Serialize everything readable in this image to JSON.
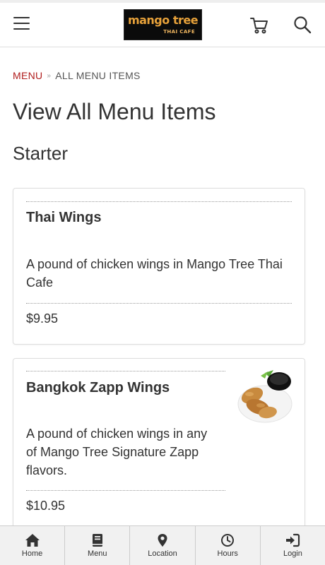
{
  "header": {
    "logo": {
      "main": "mango tree",
      "sub": "THAI CAFE"
    }
  },
  "breadcrumb": {
    "parent": "MENU",
    "separator": "»",
    "current": "ALL MENU ITEMS"
  },
  "page_title": "View All Menu Items",
  "section_title": "Starter",
  "menu_items": [
    {
      "name": "Thai Wings",
      "description_lines": [
        "A pound of chicken wings in Mango Tree Thai",
        "Cafe"
      ],
      "price": "$9.95",
      "has_image": false
    },
    {
      "name": "Bangkok Zapp Wings",
      "description_lines": [
        "A pound of chicken wings in any",
        "of Mango Tree Signature Zapp",
        "flavors."
      ],
      "price": "$10.95",
      "has_image": true
    }
  ],
  "bottom_nav": [
    {
      "label": "Home",
      "icon": "home-icon"
    },
    {
      "label": "Menu",
      "icon": "book-icon"
    },
    {
      "label": "Location",
      "icon": "map-pin-icon"
    },
    {
      "label": "Hours",
      "icon": "clock-icon"
    },
    {
      "label": "Login",
      "icon": "sign-in-icon"
    }
  ],
  "colors": {
    "breadcrumb_link": "#b01c1c",
    "logo_text": "#e8a23a",
    "logo_background": "#0b0b0b"
  }
}
